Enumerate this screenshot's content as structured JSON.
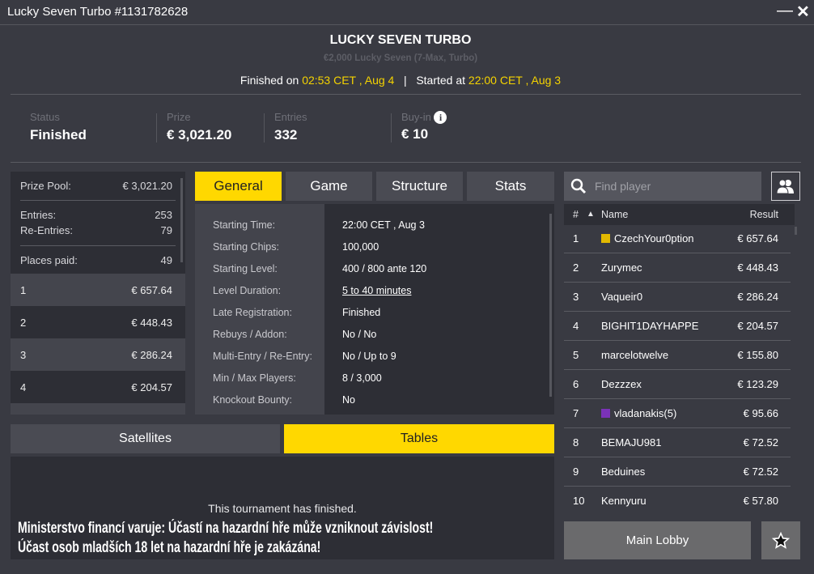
{
  "window": {
    "title": "Lucky Seven Turbo #1131782628",
    "minimize": "—",
    "close": "✕"
  },
  "header": {
    "title": "LUCKY SEVEN TURBO",
    "subtitle": "€2,000 Lucky Seven (7-Max, Turbo)",
    "finished_label": "Finished on",
    "finished_time": "02:53 CET , Aug 4",
    "separator": "|",
    "started_label": "Started at",
    "started_time": "22:00 CET , Aug 3"
  },
  "stats": [
    {
      "label": "Status",
      "value": "Finished"
    },
    {
      "label": "Prize",
      "value": "€ 3,021.20"
    },
    {
      "label": "Entries",
      "value": "332"
    },
    {
      "label": "Buy-in",
      "value": "€ 10"
    }
  ],
  "prize_panel": {
    "prize_pool_label": "Prize Pool:",
    "prize_pool": "€ 3,021.20",
    "entries_label": "Entries:",
    "entries": "253",
    "reentries_label": "Re-Entries:",
    "reentries": "79",
    "places_label": "Places paid:",
    "places": "49",
    "payouts": [
      {
        "place": "1",
        "amount": "€ 657.64"
      },
      {
        "place": "2",
        "amount": "€ 448.43"
      },
      {
        "place": "3",
        "amount": "€ 286.24"
      },
      {
        "place": "4",
        "amount": "€ 204.57"
      }
    ]
  },
  "tabs": [
    "General",
    "Game",
    "Structure",
    "Stats"
  ],
  "general": [
    {
      "label": "Starting Time:",
      "value": "22:00 CET , Aug 3"
    },
    {
      "label": "Starting Chips:",
      "value": "100,000"
    },
    {
      "label": "Starting Level:",
      "value": "400 / 800 ante 120"
    },
    {
      "label": "Level Duration:",
      "value": "5 to 40 minutes"
    },
    {
      "label": "Late Registration:",
      "value": "Finished"
    },
    {
      "label": "Rebuys / Addon:",
      "value": "No / No"
    },
    {
      "label": "Multi-Entry / Re-Entry:",
      "value": "No / Up to 9"
    },
    {
      "label": "Min / Max Players:",
      "value": "8 / 3,000"
    },
    {
      "label": "Knockout Bounty:",
      "value": "No"
    }
  ],
  "bottom_tabs": [
    "Satellites",
    "Tables"
  ],
  "tables_message": "This tournament has finished.",
  "warning": [
    "Ministerstvo financí varuje: Účastí na hazardní hře může vzniknout závislost!",
    "Účast osob mladších 18 let na hazardní hře je zakázána!"
  ],
  "search": {
    "placeholder": "Find player"
  },
  "players_header": {
    "rank": "#",
    "sort": "▲",
    "name": "Name",
    "result": "Result"
  },
  "players": [
    {
      "rank": "1",
      "name": "CzechYour0ption",
      "result": "€ 657.64",
      "flag": "#e2b900"
    },
    {
      "rank": "2",
      "name": "Zurymec",
      "result": "€ 448.43"
    },
    {
      "rank": "3",
      "name": "Vaqueir0",
      "result": "€ 286.24"
    },
    {
      "rank": "4",
      "name": "BIGHIT1DAYHAPPE",
      "result": "€ 204.57"
    },
    {
      "rank": "5",
      "name": "marcelotwelve",
      "result": "€ 155.80"
    },
    {
      "rank": "6",
      "name": "Dezzzex",
      "result": "€ 123.29"
    },
    {
      "rank": "7",
      "name": "vladanakis(5)",
      "result": "€ 95.66",
      "flag": "#7b32b8"
    },
    {
      "rank": "8",
      "name": "BEMAJU981",
      "result": "€ 72.52"
    },
    {
      "rank": "9",
      "name": "Beduines",
      "result": "€ 72.52"
    },
    {
      "rank": "10",
      "name": "Kennyuru",
      "result": "€ 57.80"
    }
  ],
  "main_lobby": "Main Lobby",
  "colors": {
    "accent": "#ffd800",
    "bg": "#393a42",
    "panel": "#2d2e35"
  }
}
